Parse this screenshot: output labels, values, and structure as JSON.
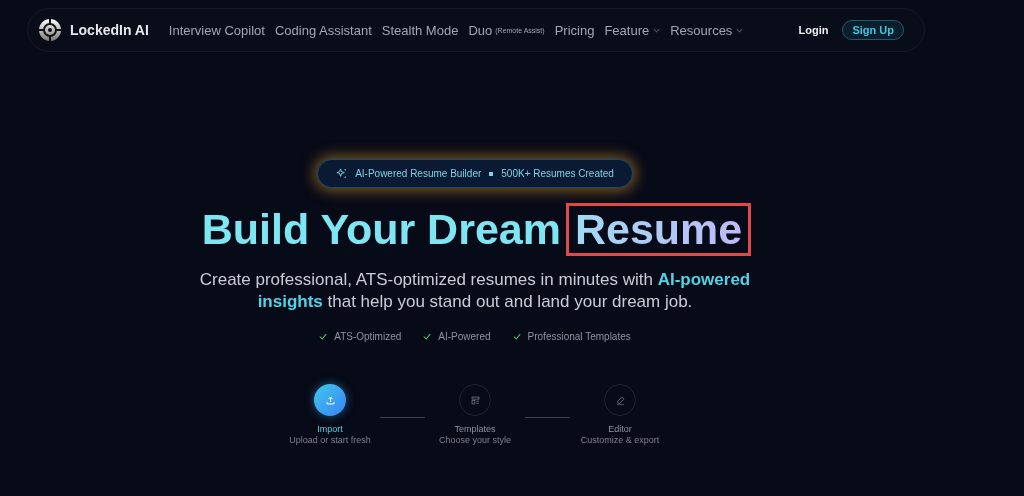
{
  "nav": {
    "brand": "LockedIn AI",
    "links": [
      {
        "label": "Interview Copilot",
        "dropdown": false
      },
      {
        "label": "Coding Assistant",
        "dropdown": false
      },
      {
        "label": "Stealth Mode",
        "dropdown": false
      },
      {
        "label": "Duo",
        "note": "(Remote Assist)",
        "dropdown": false
      },
      {
        "label": "Pricing",
        "dropdown": false
      },
      {
        "label": "Feature",
        "dropdown": true
      },
      {
        "label": "Resources",
        "dropdown": true
      }
    ],
    "login": "Login",
    "signup": "Sign Up"
  },
  "badge": {
    "left": "AI-Powered Resume Builder",
    "right": "500K+ Resumes Created"
  },
  "headline": {
    "main": "Build Your Dream",
    "accent": "Resume",
    "accent_highlighted": true
  },
  "subtitle": "Create professional, ATS-optimized resumes in minutes with **AI-powered insights** that help you stand out and land your dream job.",
  "features": [
    "ATS-Optimized",
    "AI-Powered",
    "Professional Templates"
  ],
  "steps": [
    {
      "kind": "upload",
      "title": "Import",
      "caption": "Upload or start fresh",
      "selected": true
    },
    {
      "kind": "templates",
      "title": "Templates",
      "caption": "Choose your style",
      "selected": false
    },
    {
      "kind": "editor",
      "title": "Editor",
      "caption": "Customize & export",
      "selected": false
    }
  ]
}
